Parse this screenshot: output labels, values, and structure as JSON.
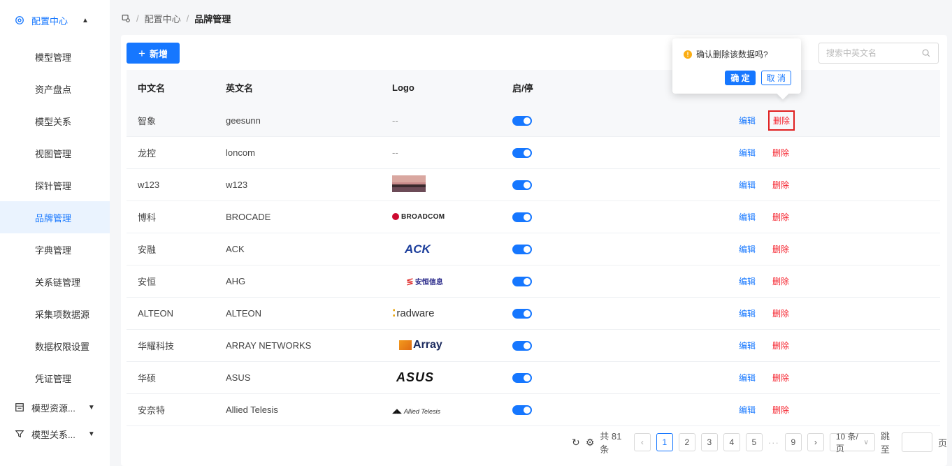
{
  "sidebar": {
    "group_label": "配置中心",
    "items": [
      {
        "label": "模型管理"
      },
      {
        "label": "资产盘点"
      },
      {
        "label": "模型关系"
      },
      {
        "label": "视图管理"
      },
      {
        "label": "探针管理"
      },
      {
        "label": "品牌管理"
      },
      {
        "label": "字典管理"
      },
      {
        "label": "关系链管理"
      },
      {
        "label": "采集项数据源"
      },
      {
        "label": "数据权限设置"
      },
      {
        "label": "凭证管理"
      }
    ],
    "sub_groups": [
      {
        "label": "模型资源..."
      },
      {
        "label": "模型关系..."
      }
    ]
  },
  "breadcrumb": {
    "items": [
      "配置中心",
      "品牌管理"
    ]
  },
  "toolbar": {
    "add_label": "新增",
    "search_placeholder": "搜索中英文名"
  },
  "table": {
    "columns": [
      "中文名",
      "英文名",
      "Logo",
      "启/停",
      ""
    ],
    "rows": [
      {
        "cn": "智象",
        "en": "geesunn",
        "logo_text": "--",
        "enabled": true,
        "edit": "编辑",
        "del": "删除"
      },
      {
        "cn": "龙控",
        "en": "loncom",
        "logo_text": "--",
        "enabled": true,
        "edit": "编辑",
        "del": "删除"
      },
      {
        "cn": "w123",
        "en": "w123",
        "logo_text": "",
        "enabled": true,
        "edit": "编辑",
        "del": "删除"
      },
      {
        "cn": "博科",
        "en": "BROCADE",
        "logo_text": "BROADCOM",
        "enabled": true,
        "edit": "编辑",
        "del": "删除"
      },
      {
        "cn": "安融",
        "en": "ACK",
        "logo_text": "ACK",
        "enabled": true,
        "edit": "编辑",
        "del": "删除"
      },
      {
        "cn": "安恒",
        "en": "AHG",
        "logo_text": "安恒信息",
        "enabled": true,
        "edit": "编辑",
        "del": "删除"
      },
      {
        "cn": "ALTEON",
        "en": "ALTEON",
        "logo_text": "radware",
        "enabled": true,
        "edit": "编辑",
        "del": "删除"
      },
      {
        "cn": "华耀科技",
        "en": "ARRAY NETWORKS",
        "logo_text": "Array",
        "enabled": true,
        "edit": "编辑",
        "del": "删除"
      },
      {
        "cn": "华硕",
        "en": "ASUS",
        "logo_text": "ASUS",
        "enabled": true,
        "edit": "编辑",
        "del": "删除"
      },
      {
        "cn": "安奈特",
        "en": "Allied Telesis",
        "logo_text": "Allied Telesis",
        "enabled": true,
        "edit": "编辑",
        "del": "删除"
      }
    ]
  },
  "popconfirm": {
    "message": "确认删除该数据吗?",
    "ok": "确 定",
    "cancel": "取 消"
  },
  "pagination": {
    "total": "共 81 条",
    "pages": [
      "1",
      "2",
      "3",
      "4",
      "5",
      "9"
    ],
    "current": "1",
    "ellipsis": "···",
    "page_size": "10 条/页",
    "jump_label": "跳至",
    "page_suffix": "页"
  },
  "colors": {
    "primary": "#1677ff",
    "danger": "#f5222d",
    "warning": "#faad14"
  }
}
